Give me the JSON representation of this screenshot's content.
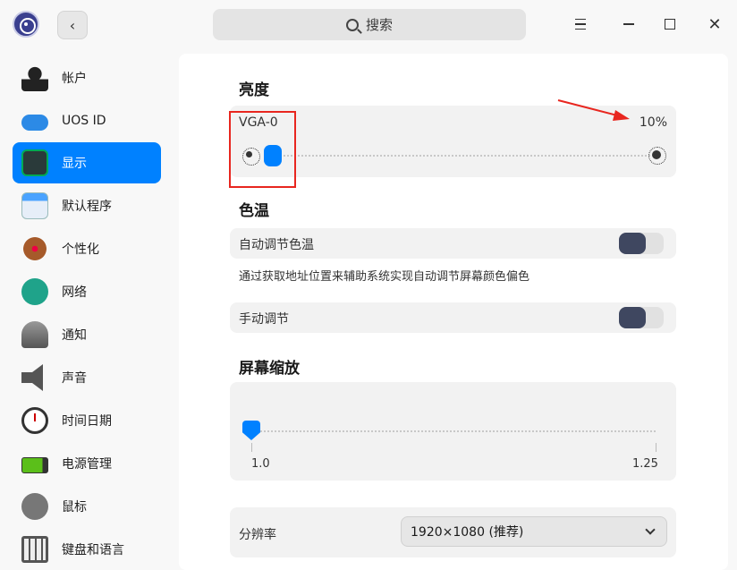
{
  "window": {
    "search_placeholder": "搜索"
  },
  "sidebar": {
    "items": [
      {
        "label": "帐户",
        "icon": "account-icon"
      },
      {
        "label": "UOS ID",
        "icon": "cloud-icon"
      },
      {
        "label": "显示",
        "icon": "display-icon",
        "active": true
      },
      {
        "label": "默认程序",
        "icon": "default-apps-icon"
      },
      {
        "label": "个性化",
        "icon": "personalization-icon"
      },
      {
        "label": "网络",
        "icon": "network-icon"
      },
      {
        "label": "通知",
        "icon": "bell-icon"
      },
      {
        "label": "声音",
        "icon": "speaker-icon"
      },
      {
        "label": "时间日期",
        "icon": "clock-icon"
      },
      {
        "label": "电源管理",
        "icon": "battery-icon"
      },
      {
        "label": "鼠标",
        "icon": "mouse-icon"
      },
      {
        "label": "键盘和语言",
        "icon": "keyboard-icon"
      }
    ]
  },
  "brightness": {
    "title": "亮度",
    "monitor": "VGA-0",
    "value_text": "10%",
    "value": 0.1
  },
  "color_temp": {
    "title": "色温",
    "auto_label": "自动调节色温",
    "auto_desc": "通过获取地址位置来辅助系统实现自动调节屏幕颜色偏色",
    "auto_on": true,
    "manual_label": "手动调节",
    "manual_on": true
  },
  "scaling": {
    "title": "屏幕缩放",
    "min_label": "1.0",
    "max_label": "1.25",
    "value": 1.0
  },
  "resolution": {
    "label": "分辨率",
    "value": "1920×1080 (推荐)"
  },
  "colors": {
    "accent": "#0081ff",
    "annotation": "#e8261f"
  }
}
